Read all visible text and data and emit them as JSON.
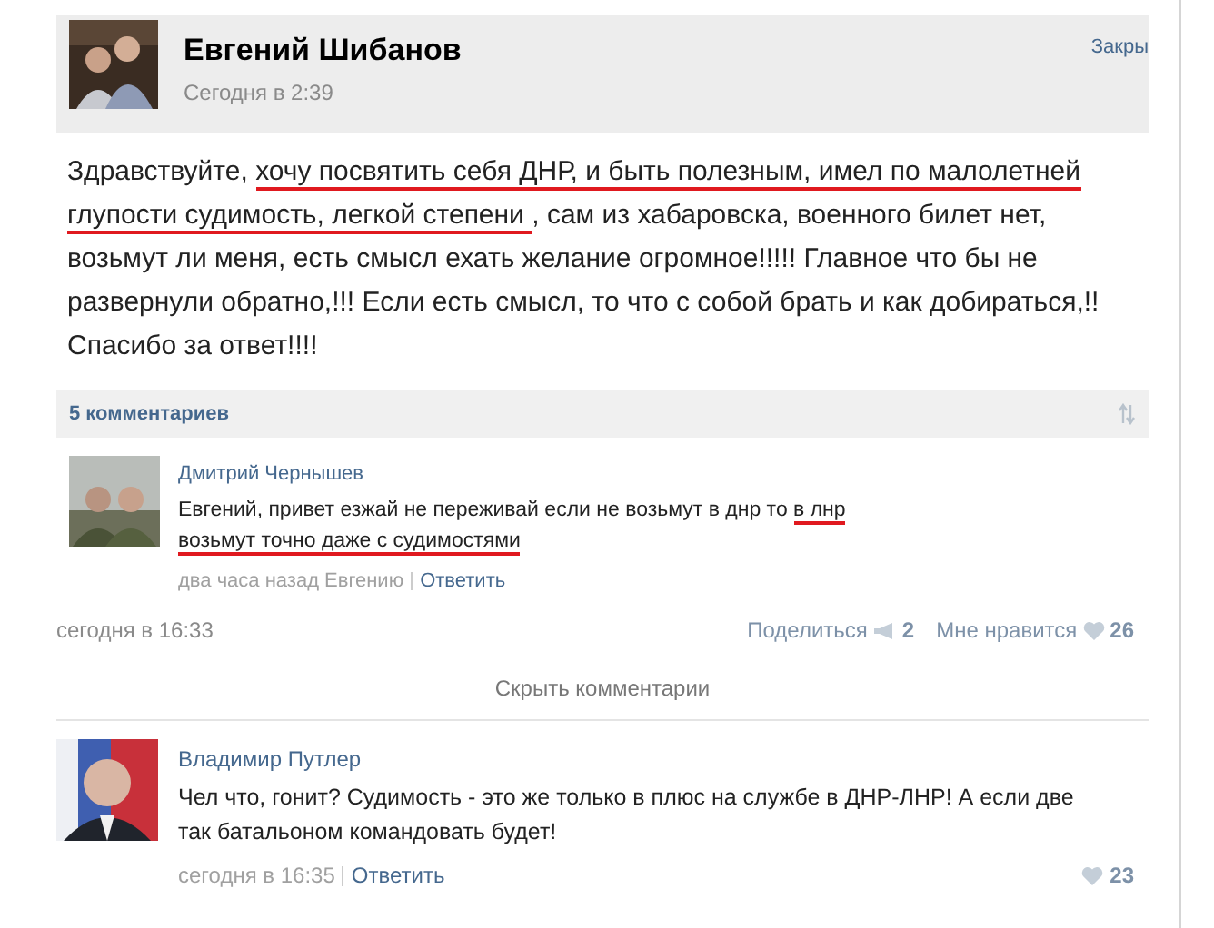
{
  "post": {
    "author": "Евгений Шибанов",
    "time": "Сегодня в 2:39",
    "close_link": "Закры",
    "text": [
      {
        "text": "Здравствуйте, ",
        "underlined": false
      },
      {
        "text": "хочу посвятить себя ДНР, и быть полезным, имел по малолетней глупости судимость, легкой степени ",
        "underlined": true
      },
      {
        "text": ", сам из хабаровска, военного билет нет, возьмут ли меня, есть смысл ехать желание огромное!!!!! Главное что бы не развернули обратно,!!! Если есть смысл, то что с собой брать и как добираться,!! Спасибо за ответ!!!!",
        "underlined": false
      }
    ]
  },
  "comments_bar": {
    "label": "5 комментариев"
  },
  "comments": [
    {
      "author": "Дмитрий Чернышев",
      "text": [
        {
          "text": "Евгений, привет езжай не переживай если не возьмут в днр то ",
          "underlined": false
        },
        {
          "text": "в лнр возьмут точно даже с судимостями",
          "underlined": true
        }
      ],
      "time": "два часа назад Евгению",
      "reply": "Ответить"
    }
  ],
  "footer": {
    "date": "сегодня в 16:33",
    "share": {
      "label": "Поделиться",
      "count": "2"
    },
    "like": {
      "label": "Мне нравится",
      "count": "26"
    }
  },
  "hide_comments": "Скрыть комментарии",
  "later_comments": [
    {
      "author": "Владимир Путлер",
      "text": [
        {
          "text": "Чел что, гонит? Судимость - это же только в плюс на службе в ДНР-ЛНР! А если две так батальоном командовать будет!",
          "underlined": false
        }
      ],
      "time": "сегодня в 16:35",
      "reply": "Ответить",
      "likes": "23"
    }
  ]
}
